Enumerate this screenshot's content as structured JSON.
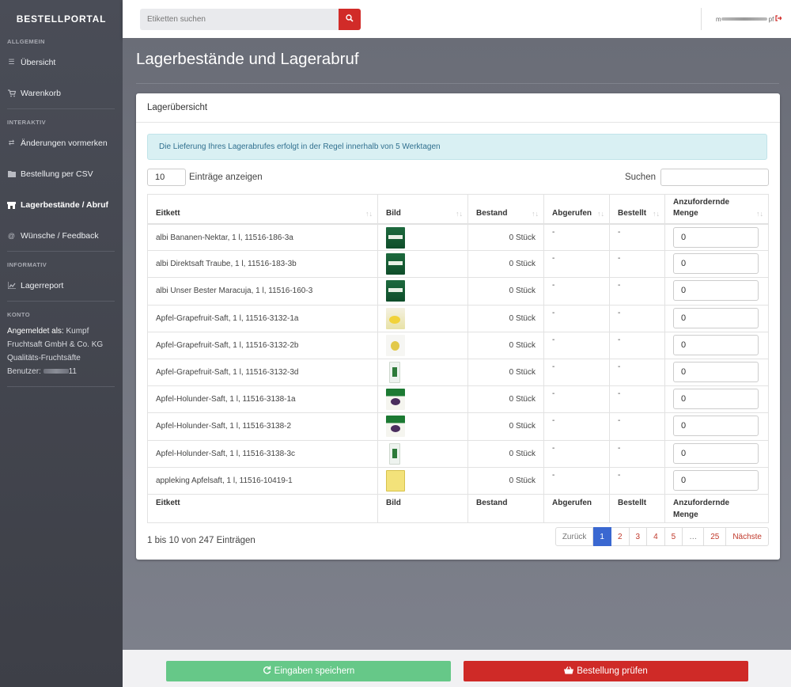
{
  "sidebar": {
    "brand": "BESTELLPORTAL",
    "sections": {
      "allgemein": "ALLGEMEIN",
      "interaktiv": "INTERAKTIV",
      "informativ": "INFORMATIV",
      "konto": "KONTO"
    },
    "items": {
      "uebersicht": "Übersicht",
      "warenkorb": "Warenkorb",
      "aenderungen": "Änderungen vormerken",
      "csv": "Bestellung per CSV",
      "lager": "Lagerbestände / Abruf",
      "wuensche": "Wünsche / Feedback",
      "lagerreport": "Lagerreport"
    },
    "konto": {
      "label": "Angemeldet als:",
      "name": "Kumpf",
      "line2": "Fruchtsaft GmbH & Co. KG",
      "line3": "Qualitäts-Fruchtsäfte",
      "benutzer_label": "Benutzer:",
      "benutzer_suffix": "11"
    }
  },
  "topbar": {
    "search_placeholder": "Etiketten suchen",
    "user_prefix": "m",
    "user_suffix": "pf"
  },
  "page": {
    "title": "Lagerbestände und Lagerabruf",
    "panel_title": "Lagerübersicht",
    "alert": "Die Lieferung Ihres Lagerabrufes erfolgt in der Regel innerhalb von 5 Werktagen",
    "length_value": "10",
    "length_label": "Einträge anzeigen",
    "search_label": "Suchen"
  },
  "table": {
    "headers": {
      "eitkett": "Eitkett",
      "bild": "Bild",
      "bestand": "Bestand",
      "abgerufen": "Abgerufen",
      "bestellt": "Bestellt",
      "menge1": "Anzufordernde",
      "menge2": "Menge"
    },
    "rows": [
      {
        "label": "albi Bananen-Nektar, 1 l, 11516-186-3a",
        "bestand": "0 Stück",
        "abgerufen": "-",
        "bestellt": "-",
        "menge": "0",
        "thumb": "green"
      },
      {
        "label": "albi Direktsaft Traube, 1 l, 11516-183-3b",
        "bestand": "0 Stück",
        "abgerufen": "-",
        "bestellt": "-",
        "menge": "0",
        "thumb": "green"
      },
      {
        "label": "albi Unser Bester Maracuja, 1 l, 11516-160-3",
        "bestand": "0 Stück",
        "abgerufen": "-",
        "bestellt": "-",
        "menge": "0",
        "thumb": "green"
      },
      {
        "label": "Apfel-Grapefruit-Saft, 1 l, 11516-3132-1a",
        "bestand": "0 Stück",
        "abgerufen": "-",
        "bestellt": "-",
        "menge": "0",
        "thumb": "yellow"
      },
      {
        "label": "Apfel-Grapefruit-Saft, 1 l, 11516-3132-2b",
        "bestand": "0 Stück",
        "abgerufen": "-",
        "bestellt": "-",
        "menge": "0",
        "thumb": "white"
      },
      {
        "label": "Apfel-Grapefruit-Saft, 1 l, 11516-3132-3d",
        "bestand": "0 Stück",
        "abgerufen": "-",
        "bestellt": "-",
        "menge": "0",
        "thumb": "tall"
      },
      {
        "label": "Apfel-Holunder-Saft, 1 l, 11516-3138-1a",
        "bestand": "0 Stück",
        "abgerufen": "-",
        "bestellt": "-",
        "menge": "0",
        "thumb": "kumpf"
      },
      {
        "label": "Apfel-Holunder-Saft, 1 l, 11516-3138-2",
        "bestand": "0 Stück",
        "abgerufen": "-",
        "bestellt": "-",
        "menge": "0",
        "thumb": "kumpf"
      },
      {
        "label": "Apfel-Holunder-Saft, 1 l, 11516-3138-3c",
        "bestand": "0 Stück",
        "abgerufen": "-",
        "bestellt": "-",
        "menge": "0",
        "thumb": "tall"
      },
      {
        "label": "appleking Apfelsaft, 1 l, 11516-10419-1",
        "bestand": "0 Stück",
        "abgerufen": "-",
        "bestellt": "-",
        "menge": "0",
        "thumb": "apple"
      }
    ]
  },
  "pagination": {
    "info": "1 bis 10 von 247 Einträgen",
    "prev": "Zurück",
    "pages": [
      "1",
      "2",
      "3",
      "4",
      "5",
      "…",
      "25"
    ],
    "next": "Nächste"
  },
  "footer": {
    "save": "Eingaben speichern",
    "check": "Bestellung prüfen"
  }
}
